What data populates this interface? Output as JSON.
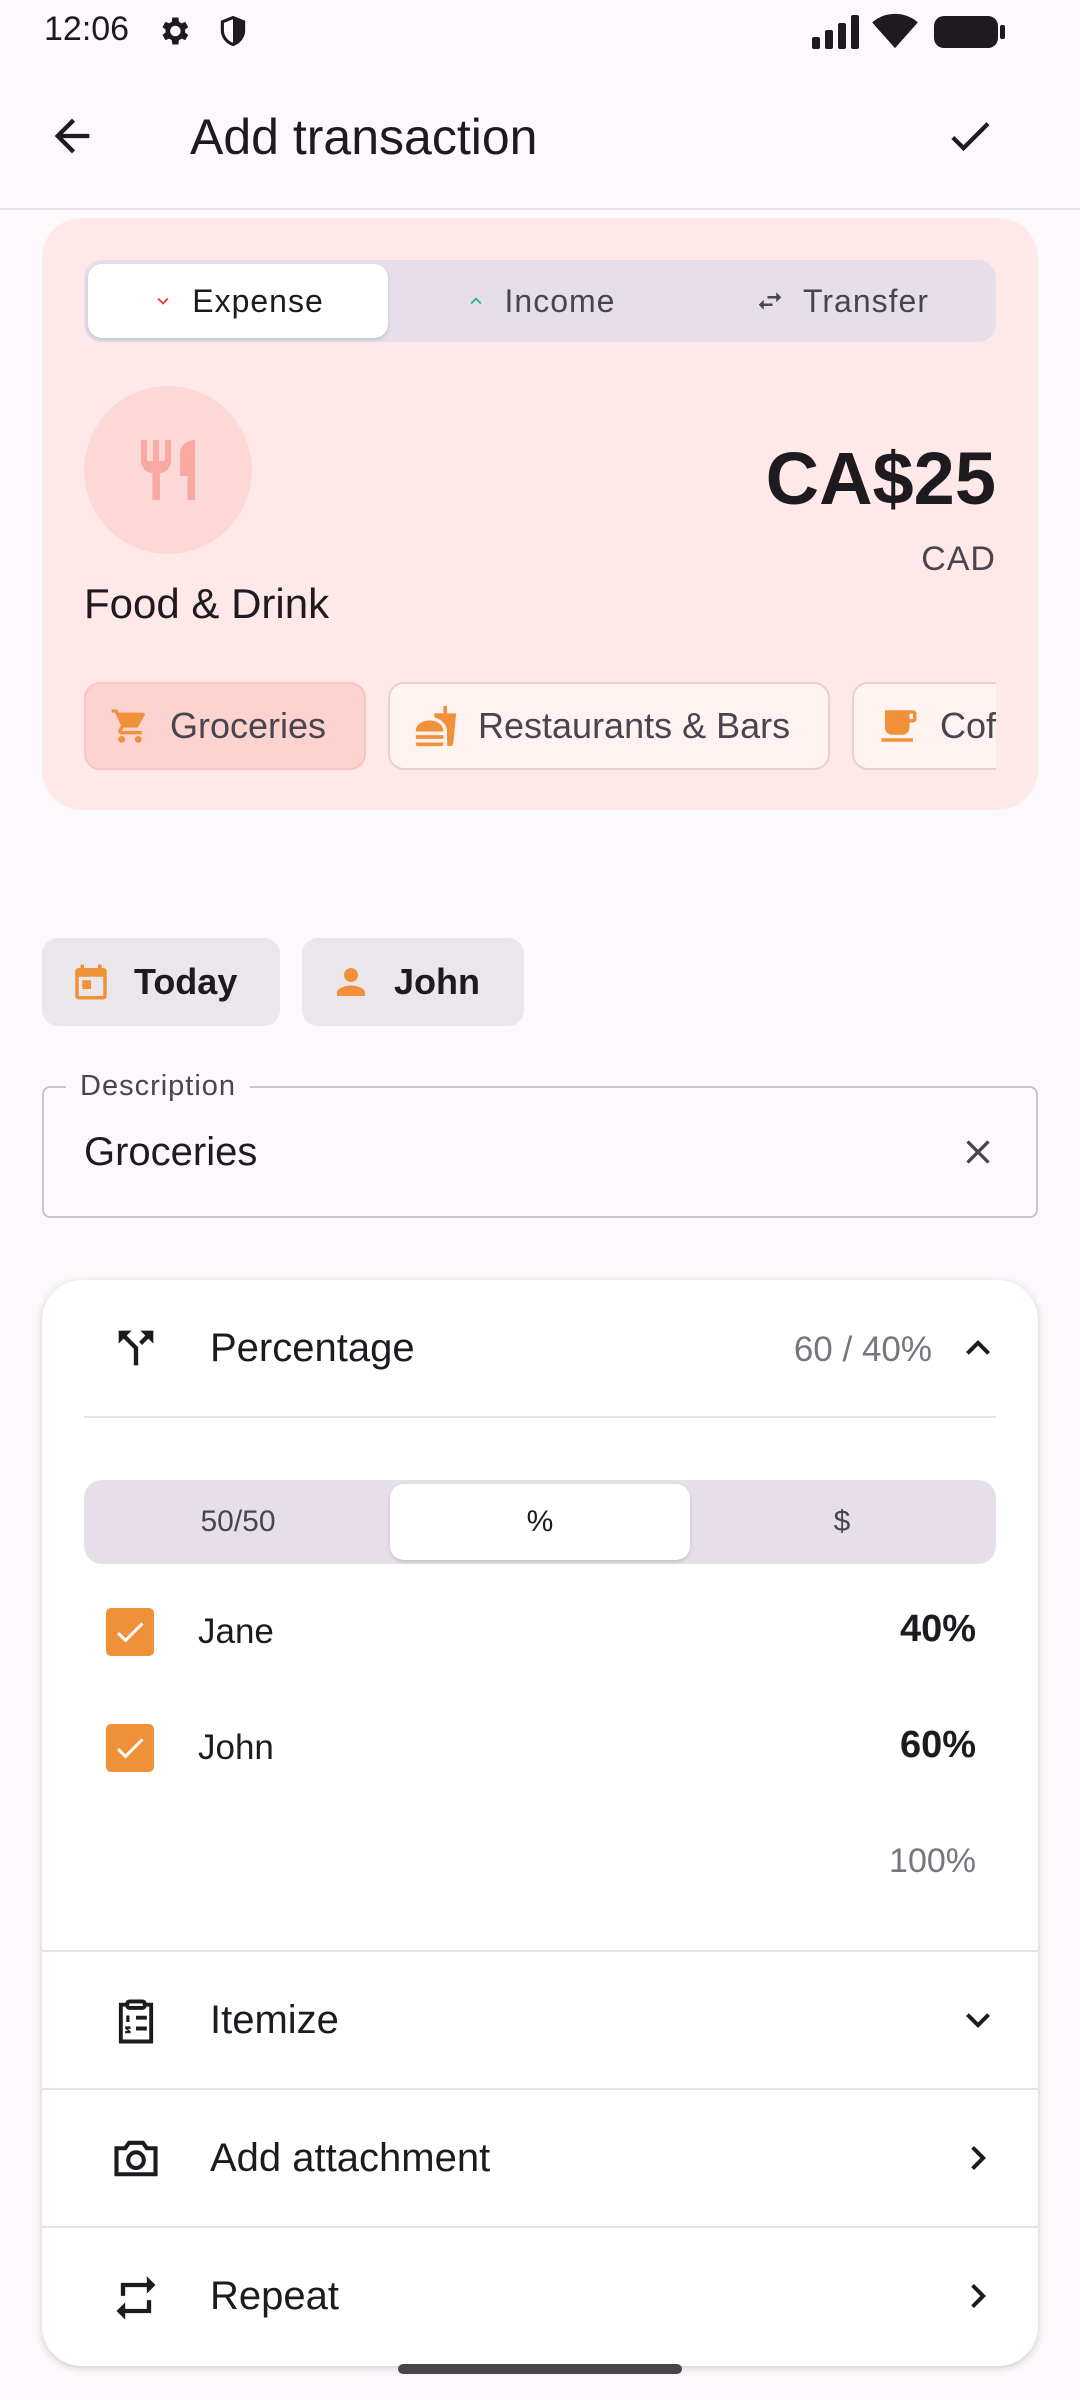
{
  "status_bar": {
    "time": "12:06"
  },
  "app_bar": {
    "title": "Add transaction"
  },
  "type_tabs": [
    {
      "label": "Expense",
      "active": true
    },
    {
      "label": "Income",
      "active": false
    },
    {
      "label": "Transfer",
      "active": false
    }
  ],
  "category": {
    "name": "Food & Drink",
    "icon": "fork-knife-icon"
  },
  "amount": {
    "value": "CA$25",
    "currency": "CAD"
  },
  "subcategories": [
    {
      "label": "Groceries",
      "icon": "cart-icon",
      "selected": true
    },
    {
      "label": "Restaurants & Bars",
      "icon": "food-icon",
      "selected": false
    },
    {
      "label": "Coffee",
      "icon": "coffee-icon",
      "selected": false
    }
  ],
  "date_chip": {
    "label": "Today"
  },
  "person_chip": {
    "label": "John"
  },
  "description": {
    "label": "Description",
    "value": "Groceries"
  },
  "split": {
    "label": "Percentage",
    "value": "60 / 40%",
    "modes": [
      "50/50",
      "%",
      "$"
    ],
    "active_mode": "%",
    "people": [
      {
        "name": "Jane",
        "checked": true,
        "percent": "40%"
      },
      {
        "name": "John",
        "checked": true,
        "percent": "60%"
      }
    ],
    "total": "100%"
  },
  "rows": {
    "itemize": "Itemize",
    "attachment": "Add attachment",
    "repeat": "Repeat"
  },
  "colors": {
    "accent": "#f0913a",
    "expense": "#e53935",
    "income": "#2eab83",
    "category_bg": "#ffe9e8",
    "category_icon": "#f8a9a1"
  }
}
